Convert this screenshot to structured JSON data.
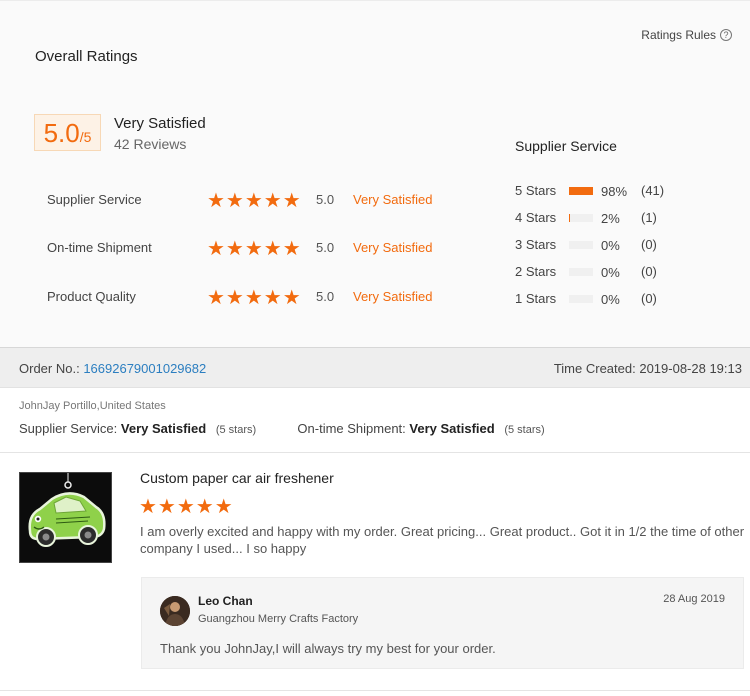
{
  "overall": {
    "title": "Overall Ratings",
    "rules_label": "Ratings Rules",
    "score": "5.0",
    "score_suffix": "/5",
    "satisfaction": "Very Satisfied",
    "reviews": "42 Reviews"
  },
  "ratings": [
    {
      "label": "Supplier Service",
      "stars": "★★★★★",
      "value": "5.0",
      "word": "Very Satisfied"
    },
    {
      "label": "On-time Shipment",
      "stars": "★★★★★",
      "value": "5.0",
      "word": "Very Satisfied"
    },
    {
      "label": "Product Quality",
      "stars": "★★★★★",
      "value": "5.0",
      "word": "Very Satisfied"
    }
  ],
  "supplier_service": {
    "title": "Supplier Service",
    "distribution": [
      {
        "label": "5 Stars",
        "percent": "98%",
        "fraction": 0.98,
        "count": "(41)"
      },
      {
        "label": "4 Stars",
        "percent": "2%",
        "fraction": 0.02,
        "count": "(1)"
      },
      {
        "label": "3 Stars",
        "percent": "0%",
        "fraction": 0,
        "count": "(0)"
      },
      {
        "label": "2 Stars",
        "percent": "0%",
        "fraction": 0,
        "count": "(0)"
      },
      {
        "label": "1 Stars",
        "percent": "0%",
        "fraction": 0,
        "count": "(0)"
      }
    ]
  },
  "order": {
    "label": "Order No.:",
    "number": "16692679001029682",
    "time_label": "Time Created:",
    "time": "2019-08-28 19:13"
  },
  "review": {
    "buyer": "JohnJay Portillo,United States",
    "supplier_label": "Supplier Service:",
    "supplier_value": "Very Satisfied",
    "supplier_stars": "(5 stars)",
    "shipment_label": "On-time Shipment:",
    "shipment_value": "Very Satisfied",
    "shipment_stars": "(5 stars)",
    "product_title": "Custom paper car air freshener",
    "stars": "★★★★★",
    "comment": "I am overly excited and happy with my order. Great pricing... Great product.. Got it in 1/2 the time of other company I used... I  so happy"
  },
  "reply": {
    "name": "Leo Chan",
    "company": "Guangzhou Merry Crafts Factory",
    "date": "28 Aug 2019",
    "text": "Thank you JohnJay,I will always try my best for your order."
  },
  "colors": {
    "accent": "#f26b0f",
    "link": "#2b7ec0"
  }
}
